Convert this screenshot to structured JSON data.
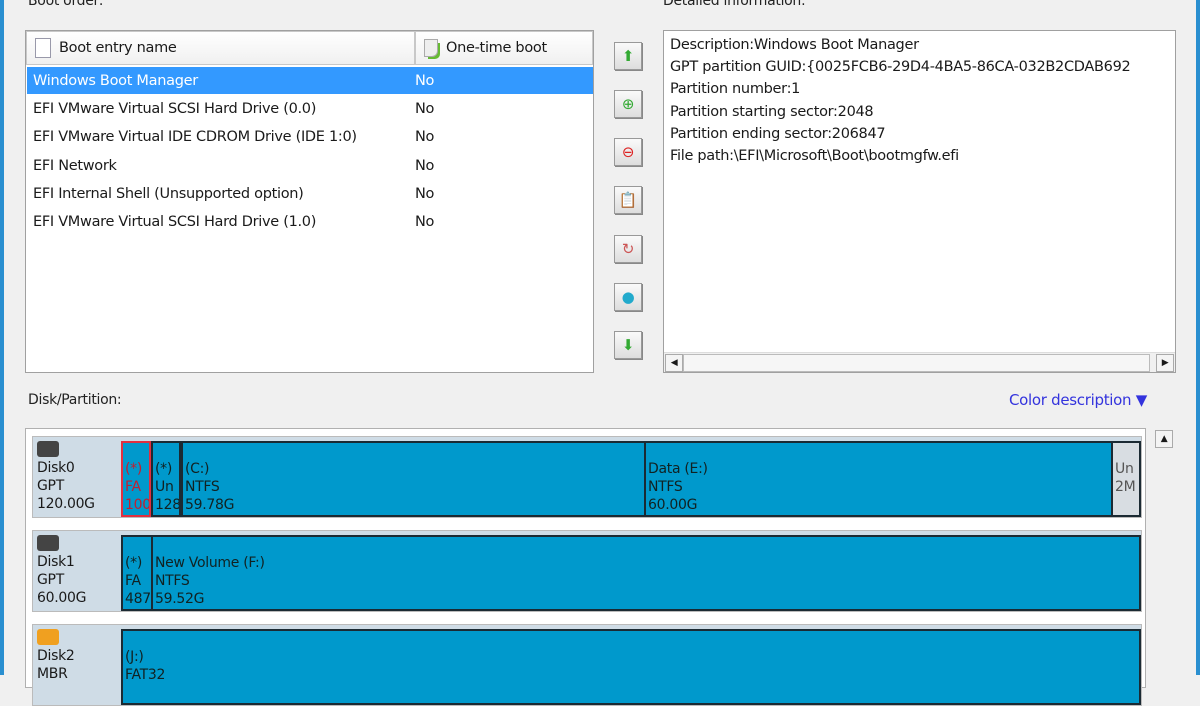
{
  "boot_order": {
    "label": "Boot order:",
    "columns": [
      "Boot entry name",
      "One-time boot"
    ],
    "entries": [
      {
        "name": "Windows Boot Manager",
        "one_time": "No",
        "selected": true
      },
      {
        "name": "EFI VMware Virtual SCSI Hard Drive (0.0)",
        "one_time": "No"
      },
      {
        "name": "EFI VMware Virtual IDE CDROM Drive (IDE 1:0)",
        "one_time": "No"
      },
      {
        "name": "EFI Network",
        "one_time": "No"
      },
      {
        "name": "EFI Internal Shell (Unsupported option)",
        "one_time": "No"
      },
      {
        "name": "EFI VMware Virtual SCSI Hard Drive (1.0)",
        "one_time": "No"
      }
    ]
  },
  "toolbar": [
    "move-up",
    "add-entry",
    "delete-entry",
    "edit-entry",
    "backup-entry",
    "network-entry",
    "move-down"
  ],
  "detail": {
    "label": "Detailed information:",
    "lines": [
      "Description:Windows Boot Manager",
      "GPT partition GUID:{0025FCB6-29D4-4BA5-86CA-032B2CDAB692",
      "Partition number:1",
      "Partition starting sector:2048",
      "Partition ending sector:206847",
      "File path:\\EFI\\Microsoft\\Boot\\bootmgfw.efi"
    ]
  },
  "disk_panel": {
    "label": "Disk/Partition:",
    "color_description": "Color description ▼"
  },
  "disks": [
    {
      "name": "Disk0",
      "type": "GPT",
      "size": "120.00G",
      "partitions": [
        {
          "l1": "(*)",
          "l2": "FA",
          "l3": "100"
        },
        {
          "l1": "(*)",
          "l2": "Un",
          "l3": "128"
        },
        {
          "l1": "(C:)",
          "l2": "NTFS",
          "l3": "59.78G"
        },
        {
          "l1": "Data (E:)",
          "l2": "NTFS",
          "l3": "60.00G"
        },
        {
          "l1": "",
          "l2": "Un",
          "l3": "2M"
        }
      ]
    },
    {
      "name": "Disk1",
      "type": "GPT",
      "size": "60.00G",
      "partitions": [
        {
          "l1": "(*)",
          "l2": "FA",
          "l3": "487"
        },
        {
          "l1": "New Volume (F:)",
          "l2": "NTFS",
          "l3": "59.52G"
        }
      ]
    },
    {
      "name": "Disk2",
      "type": "MBR",
      "size": "",
      "partitions": [
        {
          "l1": "(J:)",
          "l2": "FAT32",
          "l3": ""
        }
      ]
    }
  ],
  "colors": {
    "partition": "#0099cc",
    "selection": "#3399ff",
    "link": "#3333dd"
  }
}
